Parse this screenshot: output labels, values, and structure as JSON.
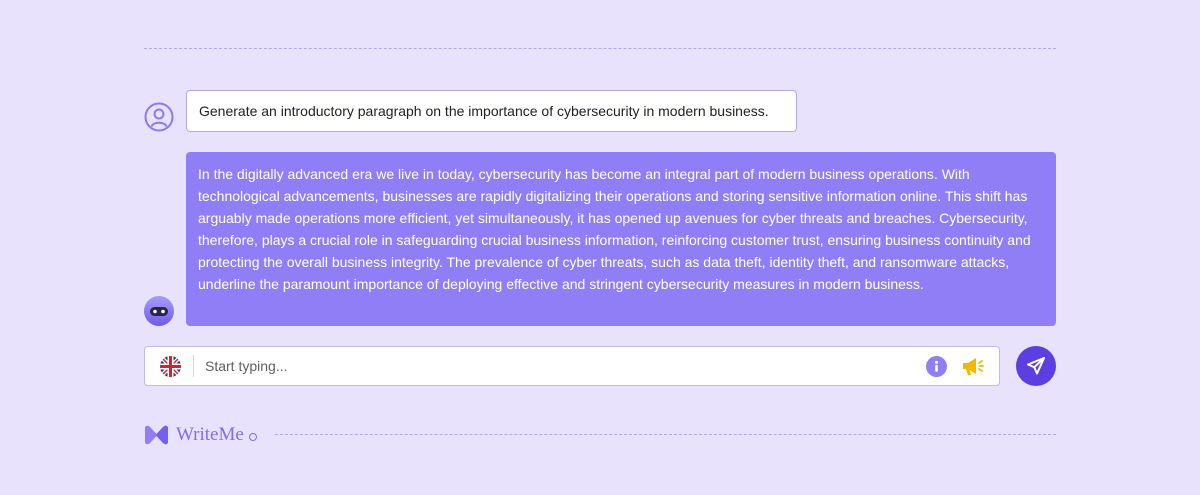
{
  "conversation": {
    "user_message": "Generate an introductory paragraph on the importance of cybersecurity in modern business.",
    "bot_message": "In the digitally advanced era we live in today, cybersecurity has become an integral part of modern business operations. With technological advancements, businesses are rapidly digitalizing their operations and storing sensitive information online. This shift has arguably made operations more efficient, yet simultaneously, it has opened up avenues for cyber threats and breaches. Cybersecurity, therefore, plays a crucial role in safeguarding crucial business information, reinforcing customer trust, ensuring business continuity and protecting the overall business integrity. The prevalence of cyber threats, such as data theft, identity theft, and ransomware attacks, underline the paramount importance of deploying effective and stringent cybersecurity measures in modern business."
  },
  "composer": {
    "placeholder": "Start typing...",
    "value": "",
    "language_icon": "uk-flag-icon",
    "info_icon": "info-icon",
    "announce_icon": "megaphone-icon",
    "send_icon": "send-icon"
  },
  "brand": {
    "name": "WriteMe"
  },
  "colors": {
    "background": "#e8e2fc",
    "bot_bubble": "#8f7ef5",
    "accent": "#5b3fe0",
    "brand": "#7f6ef0",
    "megaphone": "#f5b800"
  }
}
